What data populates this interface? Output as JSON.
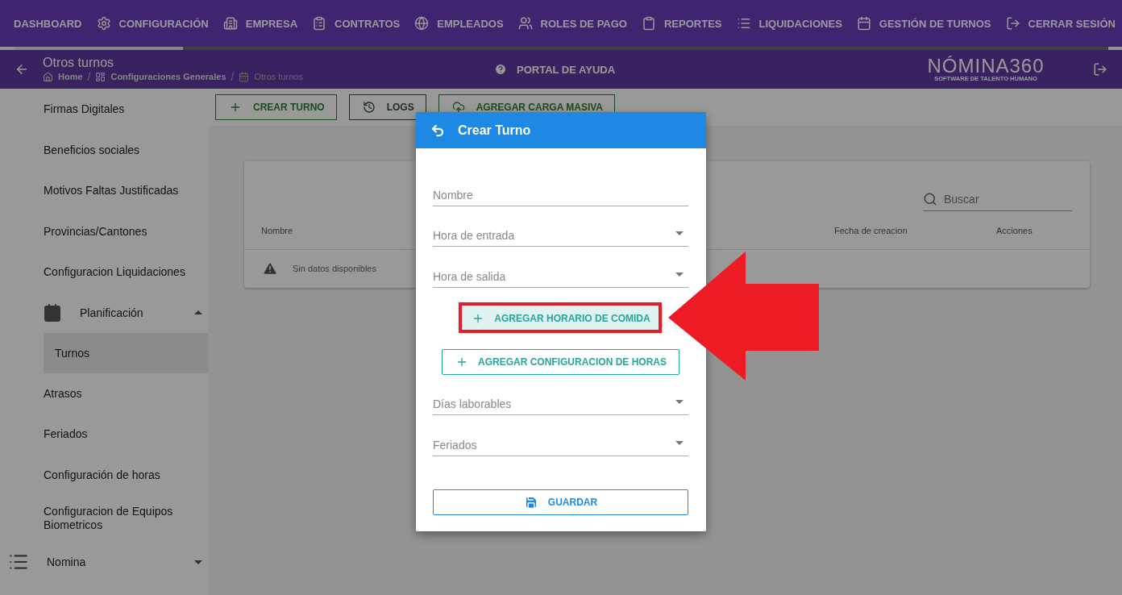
{
  "top_nav": {
    "items": [
      {
        "label": "DASHBOARD"
      },
      {
        "label": "CONFIGURACIÓN"
      },
      {
        "label": "EMPRESA"
      },
      {
        "label": "CONTRATOS"
      },
      {
        "label": "EMPLEADOS"
      },
      {
        "label": "ROLES DE PAGO"
      },
      {
        "label": "REPORTES"
      },
      {
        "label": "LIQUIDACIONES"
      },
      {
        "label": "GESTIÓN DE TURNOS"
      },
      {
        "label": "CERRAR SESIÓN"
      }
    ],
    "progress": {
      "level": 0.155
    }
  },
  "header": {
    "title": "Otros turnos",
    "breadcrumbs": [
      "Home",
      "Configuraciones Generales",
      "Otros turnos"
    ],
    "breadcrumb_separators": [
      "/",
      "/"
    ],
    "help_link": "PORTAL DE AYUDA",
    "logo": {
      "name": "NÓMINA360",
      "tagline": "SOFTWARE DE TALENTO HUMANO"
    }
  },
  "sidebar": {
    "submenu_items": [
      {
        "label": "Firmas Digitales",
        "kind": "link"
      },
      {
        "label": "Beneficios sociales",
        "kind": "link"
      },
      {
        "label": "Motivos Faltas Justificadas",
        "kind": "link"
      },
      {
        "label": "Provincias/Cantones",
        "kind": "link"
      },
      {
        "label": "Configuracion Liquidaciones",
        "kind": "link"
      },
      {
        "label": "Planificación",
        "kind": "group",
        "expanded": true,
        "children": [
          {
            "label": "Turnos",
            "selected": true
          }
        ]
      },
      {
        "label": "Atrasos",
        "kind": "link"
      },
      {
        "label": "Feriados",
        "kind": "link"
      },
      {
        "label": "Configuración de horas",
        "kind": "link"
      },
      {
        "label": "Configuracion de Equipos Biometricos",
        "kind": "link"
      }
    ],
    "items": [
      {
        "label": "Nomina",
        "expanded": false
      }
    ]
  },
  "toolbar": {
    "buttons": [
      {
        "label": "CREAR TURNO",
        "kind": "add"
      },
      {
        "label": "LOGS",
        "kind": "logs"
      },
      {
        "label": "AGREGAR CARGA MASIVA",
        "kind": "upload"
      }
    ]
  },
  "table": {
    "search": {
      "placeholder": "Buscar"
    },
    "columns": [
      "Nombre",
      "Fecha de creacion",
      "Acciones"
    ],
    "empty_message": "Sin datos disponibles"
  },
  "dialog": {
    "title": "Crear Turno",
    "fields": [
      {
        "placeholder": "Nombre",
        "kind": "text"
      },
      {
        "placeholder": "Hora de entrada",
        "kind": "select"
      },
      {
        "placeholder": "Hora de salida",
        "kind": "select"
      }
    ],
    "actions": [
      {
        "label": "AGREGAR HORARIO DE COMIDA",
        "highlighted": true
      },
      {
        "label": "AGREGAR CONFIGURACION DE HORAS",
        "highlighted": false
      }
    ],
    "more_fields": [
      {
        "placeholder": "Días laborables",
        "kind": "select"
      },
      {
        "placeholder": "Feriados",
        "kind": "select"
      }
    ],
    "save_button": "GUARDAR"
  }
}
